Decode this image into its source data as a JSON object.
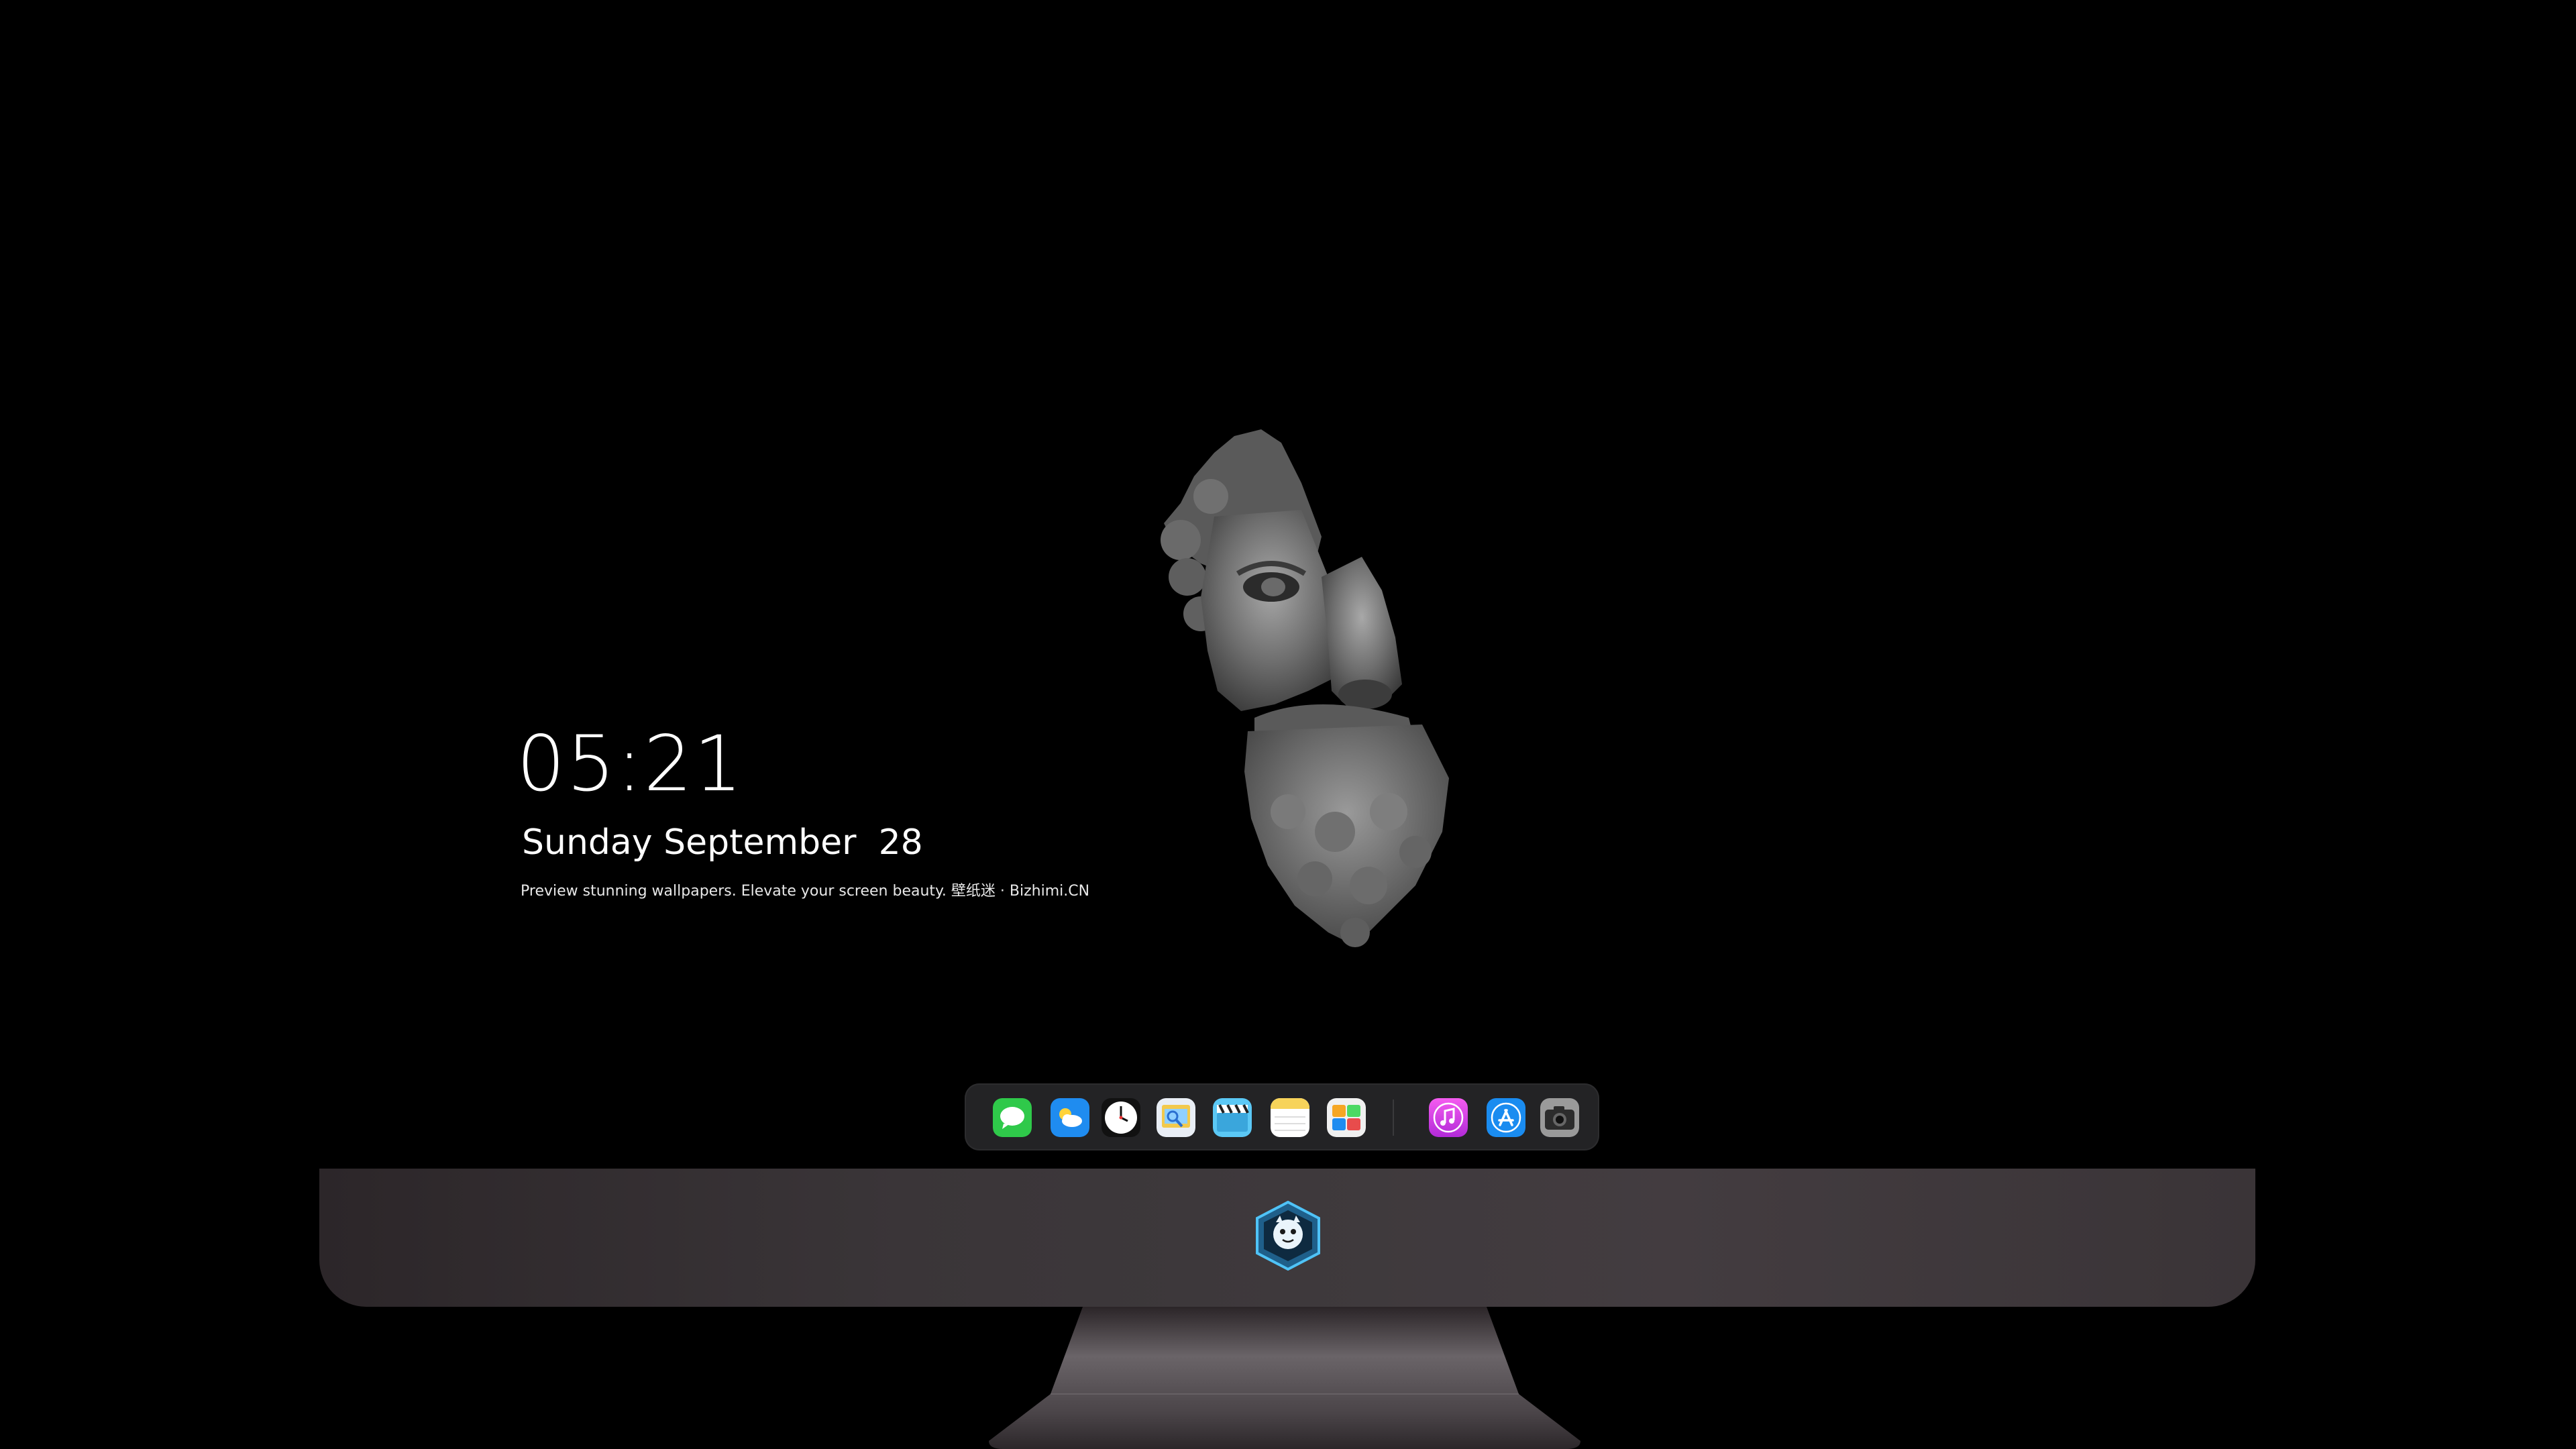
{
  "lockscreen": {
    "time": "05:21",
    "weekday": "Sunday",
    "month": "September",
    "day": "28",
    "tagline": "Preview stunning wallpapers. Elevate your screen beauty. 壁纸迷 · Bizhimi.CN"
  },
  "wallpaper": {
    "subject": "marble-statue-face-fragment"
  },
  "dock": {
    "apps": [
      {
        "name": "Messages",
        "icon": "messages-icon",
        "color": "#2fc94a"
      },
      {
        "name": "Weather",
        "icon": "weather-icon",
        "color": "#1f8cf0"
      },
      {
        "name": "Clock",
        "icon": "clock-icon",
        "color": "#ffffff"
      },
      {
        "name": "Preview",
        "icon": "preview-icon",
        "color": "#f2c94c"
      },
      {
        "name": "Clips",
        "icon": "clips-icon",
        "color": "#5bc8f5"
      },
      {
        "name": "Notes",
        "icon": "notes-icon",
        "color": "#f7d35a"
      },
      {
        "name": "Game Center",
        "icon": "gamecenter-icon",
        "color": "#e8e8e8"
      },
      {
        "name": "iTunes",
        "icon": "itunes-icon",
        "color": "#e84cf0"
      },
      {
        "name": "App Store",
        "icon": "appstore-icon",
        "color": "#1a8cf0"
      },
      {
        "name": "Camera",
        "icon": "camera-icon",
        "color": "#9a9a9a"
      }
    ]
  },
  "monitor": {
    "logo": "dragon-mascot-logo",
    "chin_color": "#3a3538",
    "stand_color": "#4a4448"
  }
}
